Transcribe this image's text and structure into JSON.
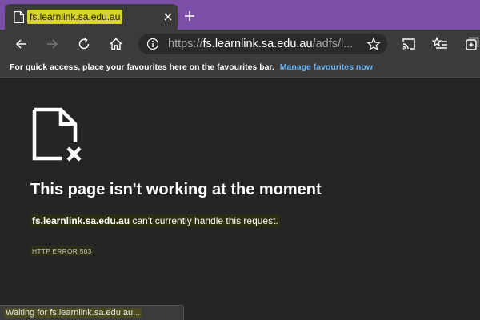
{
  "tab": {
    "title": "fs.learnlink.sa.edu.au"
  },
  "address_bar": {
    "url_scheme": "https://",
    "url_host": "fs.learnlink.sa.edu.au",
    "url_path": "/adfs/l..."
  },
  "favourites_bar": {
    "prompt": "For quick access, place your favourites here on the favourites bar.",
    "link": "Manage favourites now"
  },
  "error_page": {
    "title": "This page isn't working at the moment",
    "host": "fs.learnlink.sa.edu.au",
    "message": " can't currently handle this request.",
    "code": "HTTP ERROR 503"
  },
  "status_bar": {
    "text": "Waiting for fs.learnlink.sa.edu.au..."
  },
  "icons": {
    "tab_favicon": "page-icon",
    "tab_close": "close-icon",
    "new_tab": "plus-icon",
    "back": "back-arrow-icon",
    "forward": "forward-arrow-icon",
    "refresh": "refresh-icon",
    "home": "home-icon",
    "site_info": "info-icon",
    "favourite": "star-icon",
    "cast": "cast-icon",
    "favourites_list": "favourites-list-icon",
    "collections": "collections-icon",
    "error_document": "broken-document-icon"
  },
  "colors": {
    "tabstrip": "#7b4fa8",
    "toolbar": "#3b3b3b",
    "page_background": "#252525",
    "link": "#6ab4f5",
    "highlight": "#d8d52a"
  }
}
